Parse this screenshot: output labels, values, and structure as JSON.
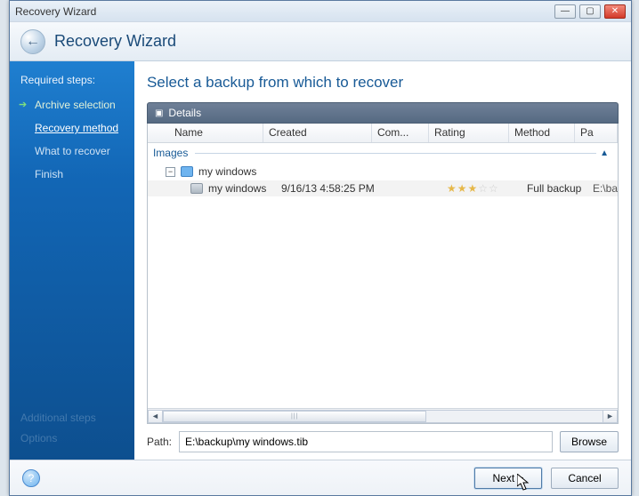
{
  "window": {
    "title": "Recovery Wizard"
  },
  "header": {
    "title": "Recovery Wizard"
  },
  "sidebar": {
    "required_label": "Required steps:",
    "steps": [
      {
        "label": "Archive selection",
        "done": true
      },
      {
        "label": "Recovery method",
        "current": true
      },
      {
        "label": "What to recover"
      },
      {
        "label": "Finish"
      }
    ],
    "faded": [
      "Additional steps",
      "Options"
    ]
  },
  "main": {
    "heading": "Select a backup from which to recover",
    "details_label": "Details",
    "columns": {
      "name": "Name",
      "created": "Created",
      "comment": "Com...",
      "rating": "Rating",
      "method": "Method",
      "path": "Pa"
    },
    "group_label": "Images",
    "tree": {
      "node_label": "my windows",
      "expanded": true,
      "children": [
        {
          "name": "my windows",
          "created": "9/16/13 4:58:25 PM",
          "comment": "",
          "rating": 3,
          "method": "Full backup",
          "path": "E:\\ba"
        }
      ]
    },
    "path_label": "Path:",
    "path_value": "E:\\backup\\my windows.tib",
    "browse_label": "Browse"
  },
  "footer": {
    "next": "Next >",
    "cancel": "Cancel"
  }
}
